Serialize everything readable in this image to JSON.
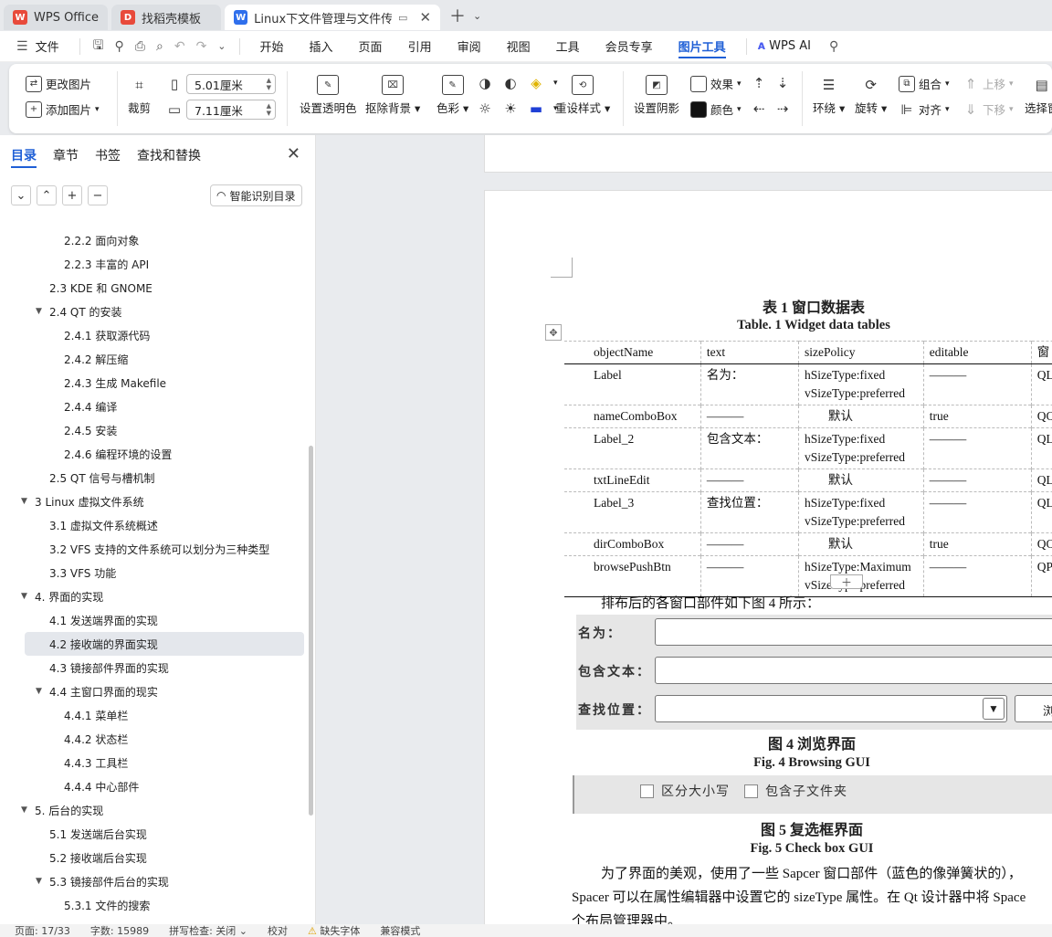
{
  "tabs": [
    {
      "label": "WPS Office",
      "color": "#e84a3b",
      "icon": "wps-logo-icon"
    },
    {
      "label": "找稻壳模板",
      "color": "#e84a3b",
      "icon": "docer-logo-icon"
    },
    {
      "label": "Linux下文件管理与文件传送的",
      "color": "#2f6fec",
      "icon": "writer-logo-icon"
    }
  ],
  "menubar": {
    "file": "文件",
    "items": [
      "开始",
      "插入",
      "页面",
      "引用",
      "审阅",
      "视图",
      "工具",
      "会员专享",
      "图片工具"
    ],
    "selected": "图片工具",
    "wps_ai": "WPS AI"
  },
  "ribbon": {
    "change_image": "更改图片",
    "add_image": "添加图片",
    "crop": "裁剪",
    "width_value": "5.01厘米",
    "height_value": "7.11厘米",
    "set_transparent": "设置透明色",
    "remove_bg": "抠除背景",
    "color": "色彩",
    "reset_style": "重设样式",
    "set_shadow": "设置阴影",
    "effects": "效果",
    "shade_color": "颜色",
    "wrap": "环绕",
    "rotate": "旋转",
    "group": "组合",
    "align": "对齐",
    "bring_forward": "上移",
    "send_backward": "下移",
    "select": "选择窗"
  },
  "nav": {
    "tabs": [
      "目录",
      "章节",
      "书签",
      "查找和替换"
    ],
    "active_tab": "目录",
    "smart_toc": "智能识别目录",
    "toc": [
      {
        "label": "2.2.2 面向对象",
        "level": 3
      },
      {
        "label": "2.2.3 丰富的 API",
        "level": 3
      },
      {
        "label": "2.3   KDE 和 GNOME",
        "level": 2
      },
      {
        "label": "2.4  QT 的安装",
        "level": 2,
        "expanded": true
      },
      {
        "label": "2.4.1 获取源代码",
        "level": 3
      },
      {
        "label": "2.4.2 解压缩",
        "level": 3
      },
      {
        "label": "2.4.3 生成 Makefile",
        "level": 3
      },
      {
        "label": "2.4.4 编译",
        "level": 3
      },
      {
        "label": "2.4.5 安装",
        "level": 3
      },
      {
        "label": "2.4.6  编程环境的设置",
        "level": 3
      },
      {
        "label": "2.5  QT 信号与槽机制",
        "level": 2
      },
      {
        "label": "3  Linux 虚拟文件系统",
        "level": 1,
        "expanded": true
      },
      {
        "label": "3.1 虚拟文件系统概述",
        "level": 2
      },
      {
        "label": "3.2  VFS 支持的文件系统可以划分为三种类型",
        "level": 2
      },
      {
        "label": "3.3 VFS 功能",
        "level": 2
      },
      {
        "label": "4.  界面的实现",
        "level": 1,
        "expanded": true
      },
      {
        "label": "4.1 发送端界面的实现",
        "level": 2
      },
      {
        "label": "4.2 接收端的界面实现",
        "level": 2,
        "highlighted": true
      },
      {
        "label": "4.3 镜接部件界面的实现",
        "level": 2
      },
      {
        "label": "4.4 主窗口界面的现实",
        "level": 2,
        "expanded": true
      },
      {
        "label": "4.4.1 菜单栏",
        "level": 3
      },
      {
        "label": "4.4.2 状态栏",
        "level": 3
      },
      {
        "label": "4.4.3 工具栏",
        "level": 3
      },
      {
        "label": "4.4.4 中心部件",
        "level": 3
      },
      {
        "label": "5. 后台的实现",
        "level": 1,
        "expanded": true
      },
      {
        "label": "5.1 发送端后台实现",
        "level": 2
      },
      {
        "label": "5.2 接收端后台实现",
        "level": 2
      },
      {
        "label": "5.3 镜接部件后台的实现",
        "level": 2,
        "expanded": true
      },
      {
        "label": "5.3.1 文件的搜索",
        "level": 3
      }
    ]
  },
  "document": {
    "table_caption_cn": "表 1  窗口数据表",
    "table_caption_en": "Table. 1  Widget data tables",
    "table_headers": [
      "objectName",
      "text",
      "sizePolicy",
      "editable",
      "窗"
    ],
    "table_rows": [
      [
        "Label",
        "名为：",
        "hSizeType:fixed\nvSizeType:preferred",
        "———",
        "QL"
      ],
      [
        "nameComboBox",
        "———",
        "默认",
        "true",
        "QC"
      ],
      [
        "Label_2",
        "包含文本：",
        "hSizeType:fixed\nvSizeType:preferred",
        "———",
        "QL"
      ],
      [
        "txtLineEdit",
        "———",
        "默认",
        "———",
        "QL"
      ],
      [
        "Label_3",
        "查找位置：",
        "hSizeType:fixed\nvSizeType:preferred",
        "———",
        "QL"
      ],
      [
        "dirComboBox",
        "———",
        "默认",
        "true",
        "QC"
      ],
      [
        "browsePushBtn",
        "———",
        "hSizeType:Maximum\nvSizeType:preferred",
        "———",
        "QP"
      ]
    ],
    "para_layout": "排布后的各窗口部件如下图 4 所示：",
    "fig4": {
      "label_name": "名为：",
      "label_contains": "包含文本：",
      "label_location": "查找位置：",
      "button_partial": "浏"
    },
    "fig4_caption_cn": "图 4  浏览界面",
    "fig4_caption_en": "Fig. 4  Browsing GUI",
    "fig5": {
      "case_sensitive": "区分大小写",
      "include_subdirs": "包含子文件夹"
    },
    "fig5_caption_cn": "图 5  复选框界面",
    "fig5_caption_en": "Fig. 5  Check box GUI",
    "body_line1": "为了界面的美观，使用了一些 Sapcer 窗口部件（蓝色的像弹簧状的），",
    "body_line2": "Spacer 可以在属性编辑器中设置它的 sizeType 属性。在 Qt 设计器中将 Space",
    "body_line3": "个布局管理器中。"
  },
  "statusbar": {
    "page": "页面: 17/33",
    "words": "字数: 15989",
    "spell": "拼写检查: 关闭",
    "proof": "校对",
    "missing_font": "缺失字体",
    "compat": "兼容模式"
  }
}
